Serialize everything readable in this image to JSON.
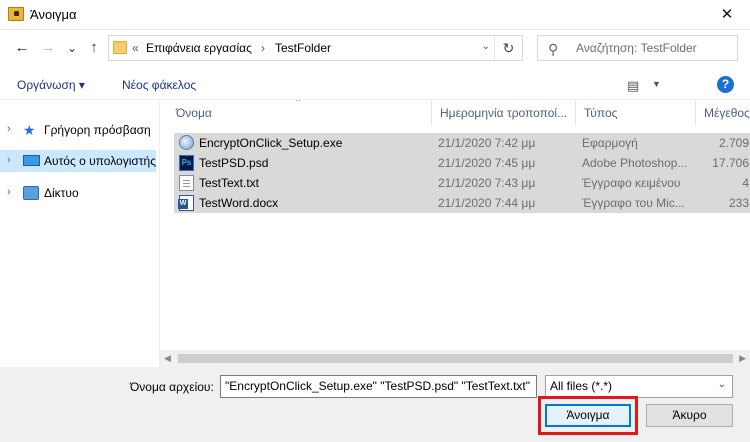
{
  "window": {
    "title": "Άνοιγμα",
    "close_glyph": "✕"
  },
  "nav": {
    "back_glyph": "←",
    "forward_glyph": "→",
    "recent_glyph": "⌄",
    "up_glyph": "↑",
    "breadcrumb_prefix": "«",
    "crumbs": [
      "Επιφάνεια εργασίας",
      "TestFolder"
    ],
    "crumb_separator": "›",
    "refresh_glyph": "↻",
    "dropdown_glyph": "⌄",
    "search_placeholder": "Αναζήτηση: TestFolder"
  },
  "commands": {
    "organize": "Οργάνωση ▾",
    "new_folder": "Νέος φάκελος",
    "view_glyph": "▤",
    "view_dropdown": "▼",
    "help": "?"
  },
  "sidebar": {
    "items": [
      {
        "label": "Γρήγορη πρόσβαση",
        "icon": "star-icon",
        "chevron": "›",
        "selected": false
      },
      {
        "label": "Αυτός ο υπολογιστής",
        "icon": "computer-icon",
        "chevron": "›",
        "selected": true
      },
      {
        "label": "Δίκτυο",
        "icon": "network-icon",
        "chevron": "›",
        "selected": false
      }
    ]
  },
  "columns": {
    "name": "Όνομα",
    "date": "Ημερομηνία τροποποί...",
    "type": "Τύπος",
    "size": "Μέγεθος",
    "sort_glyph": "^"
  },
  "files": [
    {
      "name": "EncryptOnClick_Setup.exe",
      "date": "21/1/2020 7:42 μμ",
      "type": "Εφαρμογή",
      "size": "2.709",
      "icon": "exe-icon",
      "selected": true
    },
    {
      "name": "TestPSD.psd",
      "date": "21/1/2020 7:45 μμ",
      "type": "Adobe Photoshop...",
      "size": "17.706",
      "icon": "psd-icon",
      "selected": true
    },
    {
      "name": "TestText.txt",
      "date": "21/1/2020 7:43 μμ",
      "type": "Έγγραφο κειμένου",
      "size": "4",
      "icon": "txt-icon",
      "selected": true
    },
    {
      "name": "TestWord.docx",
      "date": "21/1/2020 7:44 μμ",
      "type": "Έγγραφο του Mic...",
      "size": "233",
      "icon": "docx-icon",
      "selected": true
    }
  ],
  "psd_icon_text": "Ps",
  "scroll": {
    "left_glyph": "◀",
    "right_glyph": "▶"
  },
  "footer": {
    "filename_label": "Όνομα αρχείου:",
    "filename_value": "\"EncryptOnClick_Setup.exe\" \"TestPSD.psd\" \"TestText.txt\"",
    "filetype_value": "All files (*.*)",
    "filetype_chevron": "⌄",
    "open_label": "Άνοιγμα",
    "cancel_label": "Άκυρο"
  },
  "colors": {
    "selection": "#d9d9d9",
    "sidebar_selected": "#cce8ff",
    "highlight_box": "#e01818",
    "link_text": "#1e3287"
  }
}
